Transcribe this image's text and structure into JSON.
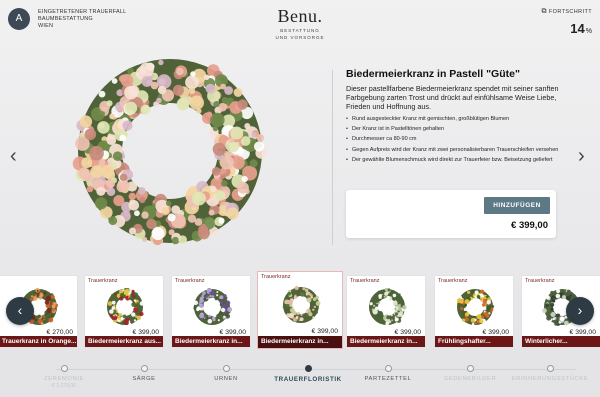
{
  "header": {
    "avatar_letter": "A",
    "company_line1": "EINGETRETENER TRAUERFALL",
    "company_line2": "BAUMBESTATTUNG",
    "company_line3": "WIEN",
    "logo": "Benu.",
    "logo_sub1": "BESTATTUNG",
    "logo_sub2": "UND VORSORGE",
    "progress_label": "FORTSCHRITT",
    "progress_value": "14",
    "progress_unit": "%"
  },
  "product": {
    "title": "Biedermeierkranz in Pastell \"Güte\"",
    "description": "Dieser pastellfarbene Biedermeierkranz spendet mit seiner sanften Farbgebung zarten Trost und drückt auf einfühlsame Weise Liebe, Frieden und Hoffnung aus.",
    "bullets": [
      "Rund ausgesteckter Kranz mit gemischten, großblütigen Blumen",
      "Der Kranz ist in Pastelltönen gehalten",
      "Durchmesser ca 80-90 cm",
      "Gegen Aufpreis wird der Kranz mit zwei personalisierbaren Trauerschleifen versehen",
      "Der gewählte Blumenschmuck wird direkt zur Trauerfeier bzw. Beisetzung geliefert"
    ],
    "add_label": "HINZUFÜGEN",
    "price": "€ 399,00"
  },
  "carousel": {
    "cards": [
      {
        "category": "",
        "price": "€ 270,00",
        "name": "Trauerkranz in Orange...",
        "palette": [
          "#c8622e",
          "#e8a35a",
          "#7a2a1a",
          "#3f5b2a"
        ]
      },
      {
        "category": "Trauerkranz",
        "price": "€ 399,00",
        "name": "Biedermeierkranz aus...",
        "palette": [
          "#a81e2a",
          "#e7c64a",
          "#ffffff",
          "#4b6b2e"
        ]
      },
      {
        "category": "Trauerkranz",
        "price": "€ 399,00",
        "name": "Biedermeierkranz in...",
        "palette": [
          "#6b4f9a",
          "#b7a6d8",
          "#ffffff",
          "#3f5b3a"
        ]
      },
      {
        "category": "Trauerkranz",
        "price": "€ 399,00",
        "name": "Biedermeierkranz in...",
        "palette": [
          "#e8b7a0",
          "#f3dcc8",
          "#c8d19a",
          "#5a6b3a"
        ]
      },
      {
        "category": "Trauerkranz",
        "price": "€ 399,00",
        "name": "Biedermeierkranz in...",
        "palette": [
          "#ffffff",
          "#e4e8d0",
          "#b9c8a0",
          "#48633a"
        ]
      },
      {
        "category": "Trauerkranz",
        "price": "€ 399,00",
        "name": "Frühlingshafter...",
        "palette": [
          "#e7c83a",
          "#d9662a",
          "#ffffff",
          "#3f5b2a"
        ]
      },
      {
        "category": "Trauerkranz",
        "price": "€ 399,00",
        "name": "Winterlicher...",
        "palette": [
          "#ffffff",
          "#cfd6d0",
          "#4a5a4a",
          "#2f3f33"
        ]
      }
    ]
  },
  "steps": [
    {
      "label": "ZEREMONIE",
      "sub": "€ 1.279,00",
      "state": "faded"
    },
    {
      "label": "SÄRGE",
      "sub": "",
      "state": "normal"
    },
    {
      "label": "URNEN",
      "sub": "",
      "state": "normal"
    },
    {
      "label": "TRAUERFLORISTIK",
      "sub": "",
      "state": "active"
    },
    {
      "label": "PARTEZETTEL",
      "sub": "",
      "state": "normal"
    },
    {
      "label": "GEDENKBILDER",
      "sub": "",
      "state": "faded"
    },
    {
      "label": "ERINNERUNGSSTÜCKE",
      "sub": "",
      "state": "faded"
    }
  ],
  "colors": {
    "accent": "#5d7985",
    "card_name_bg": "#6b1717",
    "dark_button": "#2e3a44"
  },
  "icons": {
    "prev": "chevron-left-icon",
    "next": "chevron-right-icon",
    "progress": "external-link-icon"
  }
}
